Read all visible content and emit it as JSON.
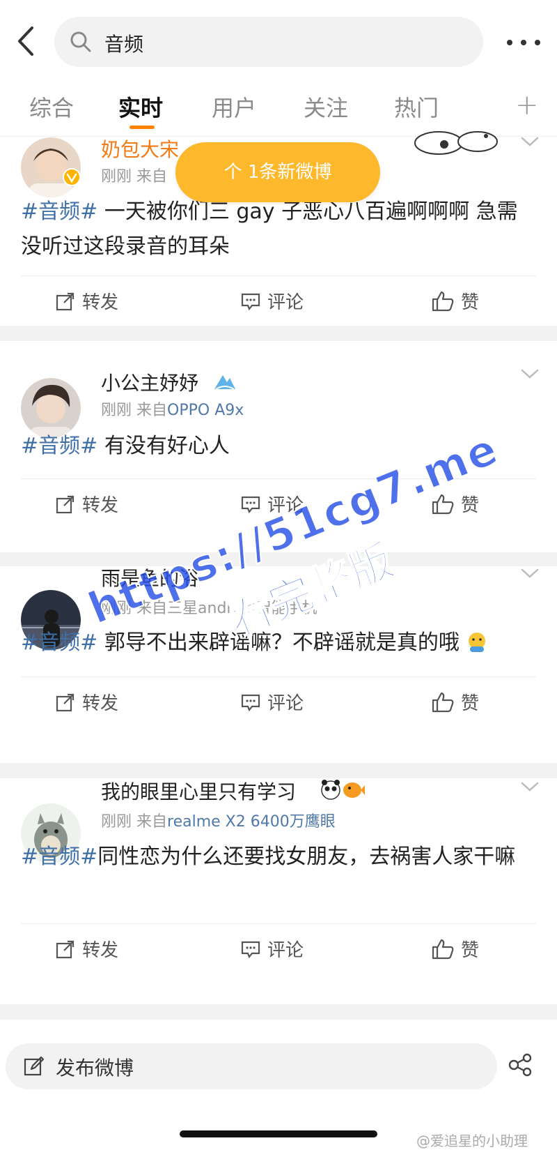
{
  "search": {
    "query": "音频"
  },
  "tabs": [
    {
      "label": "综合"
    },
    {
      "label": "实时"
    },
    {
      "label": "用户"
    },
    {
      "label": "关注"
    },
    {
      "label": "热门"
    }
  ],
  "tab_plus": "+",
  "toast": {
    "label": "个 1条新微博"
  },
  "posts": [
    {
      "username": "奶包大宋",
      "time": "刚刚",
      "from_prefix": "来自",
      "source": "",
      "tag": "#音频#",
      "text": " 一天被你们三 gay 子恶心八百遍啊啊啊 急需没听过这段录音的耳朵"
    },
    {
      "username": "小公主妤妤",
      "time": "刚刚",
      "from_prefix": "来自",
      "source": "OPPO A9x",
      "tag": "#音频#",
      "text": " 有没有好心人"
    },
    {
      "username": "雨是鱼的浴",
      "time": "刚刚",
      "from_prefix": "来自",
      "source": "三星android智能手机",
      "tag": "#音频#",
      "text": " 郭导不出来辟谣嘛？不辟谣就是真的哦"
    },
    {
      "username": "我的眼里心里只有学习",
      "time": "刚刚",
      "from_prefix": "来自",
      "source": "realme X2 6400万鹰眼",
      "tag": "#音频#",
      "text": "同性恋为什么还要找女朋友，去祸害人家干嘛"
    }
  ],
  "actions": {
    "repost": "转发",
    "comment": "评论",
    "like": "赞"
  },
  "watermark": {
    "line1": "https://51cg7.me",
    "line2": "看完整版"
  },
  "composer": {
    "label": "发布微博"
  },
  "credit": "@爱追星的小助理",
  "colors": {
    "accent": "#ff8200",
    "toast": "#fdb82b",
    "topic": "#3f6fa7"
  }
}
